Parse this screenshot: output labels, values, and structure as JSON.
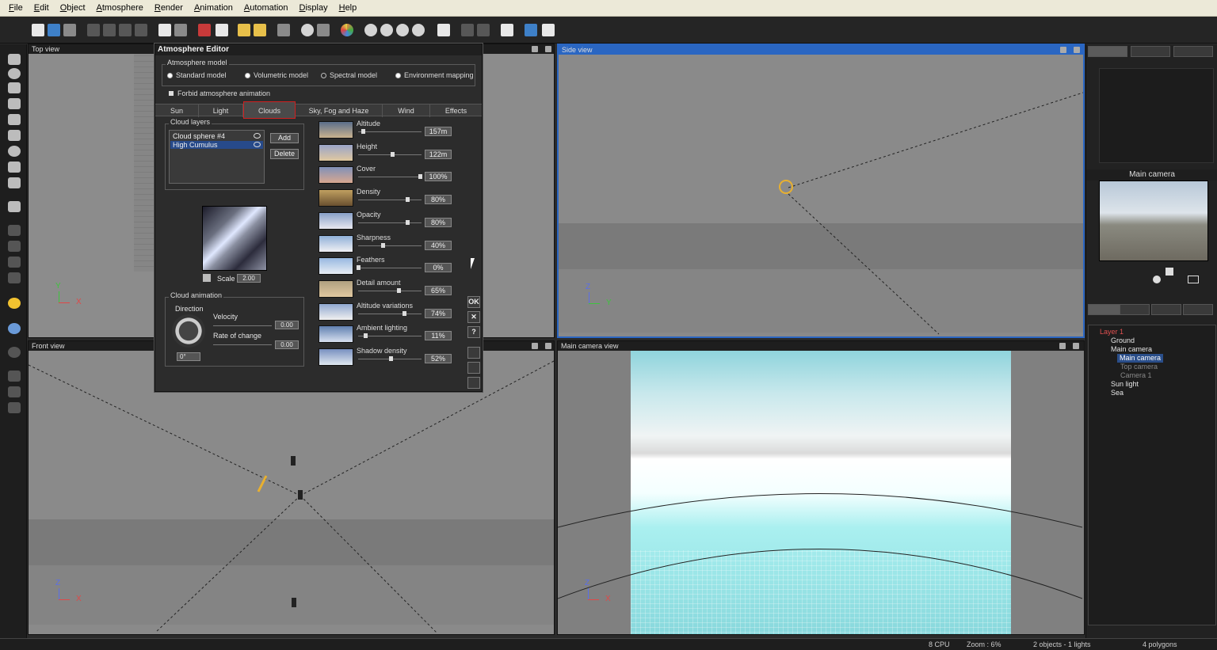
{
  "menu": [
    "File",
    "Edit",
    "Object",
    "Atmosphere",
    "Render",
    "Animation",
    "Automation",
    "Display",
    "Help"
  ],
  "viewports": {
    "top": {
      "title": "Top view"
    },
    "side": {
      "title": "Side view"
    },
    "front": {
      "title": "Front view"
    },
    "camera": {
      "title": "Main camera view"
    }
  },
  "axes": {
    "z": "Z",
    "x": "X",
    "y": "Y"
  },
  "atmosphere_editor": {
    "title": "Atmosphere Editor",
    "model_group": "Atmosphere model",
    "models": [
      "Standard model",
      "Volumetric model",
      "Spectral model",
      "Environment mapping"
    ],
    "forbid_animation": "Forbid atmosphere animation",
    "tabs": [
      "Sun",
      "Light",
      "Clouds",
      "Sky, Fog and Haze",
      "Wind",
      "Effects"
    ],
    "active_tab": "Clouds",
    "cloud_layers_label": "Cloud layers",
    "cloud_layers": [
      "Cloud sphere #4",
      "High Cumulus"
    ],
    "selected_layer": "High Cumulus",
    "add_label": "Add",
    "delete_label": "Delete",
    "scale_label": "Scale",
    "scale_value": "2.00",
    "animation_group": "Cloud animation",
    "direction_label": "Direction",
    "direction_value": "0°",
    "velocity_label": "Velocity",
    "velocity_value": "0.00",
    "rate_label": "Rate of change",
    "rate_value": "0.00",
    "params": [
      {
        "label": "Altitude",
        "value": "157m",
        "level": 0.08
      },
      {
        "label": "Height",
        "value": "122m",
        "level": 0.55
      },
      {
        "label": "Cover",
        "value": "100%",
        "level": 1.0
      },
      {
        "label": "Density",
        "value": "80%",
        "level": 0.8
      },
      {
        "label": "Opacity",
        "value": "80%",
        "level": 0.8
      },
      {
        "label": "Sharpness",
        "value": "40%",
        "level": 0.4
      },
      {
        "label": "Feathers",
        "value": "0%",
        "level": 0.0
      },
      {
        "label": "Detail amount",
        "value": "65%",
        "level": 0.65
      },
      {
        "label": "Altitude variations",
        "value": "74%",
        "level": 0.74
      },
      {
        "label": "Ambient lighting",
        "value": "11%",
        "level": 0.11
      },
      {
        "label": "Shadow density",
        "value": "52%",
        "level": 0.52
      }
    ],
    "ok_label": "OK",
    "cancel_label": "✕",
    "help_label": "?"
  },
  "camera_panel": {
    "title": "Main camera"
  },
  "scene_tree": [
    {
      "label": "Layer 1",
      "kind": "layer"
    },
    {
      "label": "Ground",
      "kind": "item"
    },
    {
      "label": "Main camera",
      "kind": "group"
    },
    {
      "label": "Main camera",
      "kind": "selected"
    },
    {
      "label": "Top camera",
      "kind": "dim"
    },
    {
      "label": "Camera 1",
      "kind": "dim"
    },
    {
      "label": "Sun light",
      "kind": "item"
    },
    {
      "label": "Sea",
      "kind": "item"
    }
  ],
  "status": {
    "cpu": "8 CPU",
    "zoom": "Zoom : 6%",
    "objects": "2 objects - 1 lights",
    "polygons": "4 polygons"
  }
}
